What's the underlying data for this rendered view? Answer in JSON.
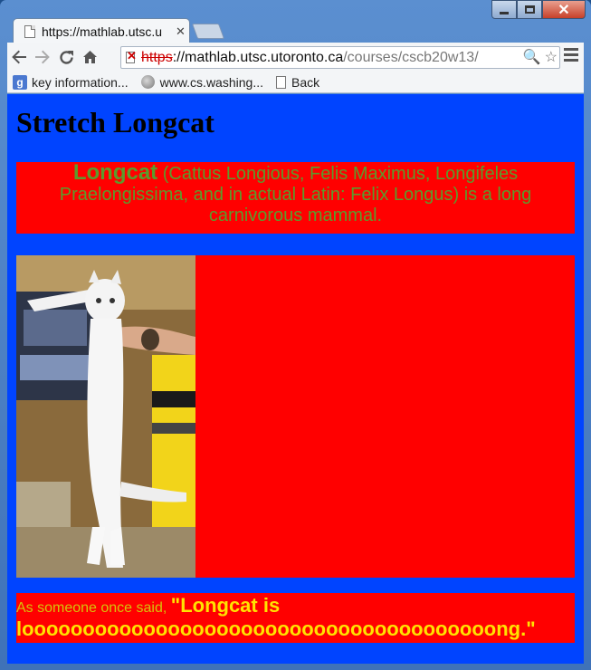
{
  "browser": {
    "tab": {
      "title": "https://mathlab.utsc.u"
    },
    "address": {
      "scheme": "https",
      "host": "://mathlab.utsc.utoronto.ca",
      "path": "/courses/cscb20w13/"
    },
    "bookmarks": [
      {
        "label": "key information..."
      },
      {
        "label": "www.cs.washing..."
      },
      {
        "label": "Back"
      }
    ]
  },
  "page": {
    "heading": "Stretch Longcat",
    "intro": {
      "lead": "Longcat",
      "text": " (Cattus Longious, Felis Maximus, Longifeles Praelongissima, and in actual Latin: Felix Longus) is a long carnivorous mammal."
    },
    "image_subject": "longcat photo",
    "quote": {
      "prefix": "As someone once said, ",
      "line1": "\"Longcat is",
      "line2": "looooooooooooooooooooooooooooooooooooooong.\""
    }
  },
  "colors": {
    "page_background": "#0044ff",
    "panel_background": "#ff0000",
    "intro_text": "#5c9b2c",
    "quote_text": "#ffe300"
  }
}
